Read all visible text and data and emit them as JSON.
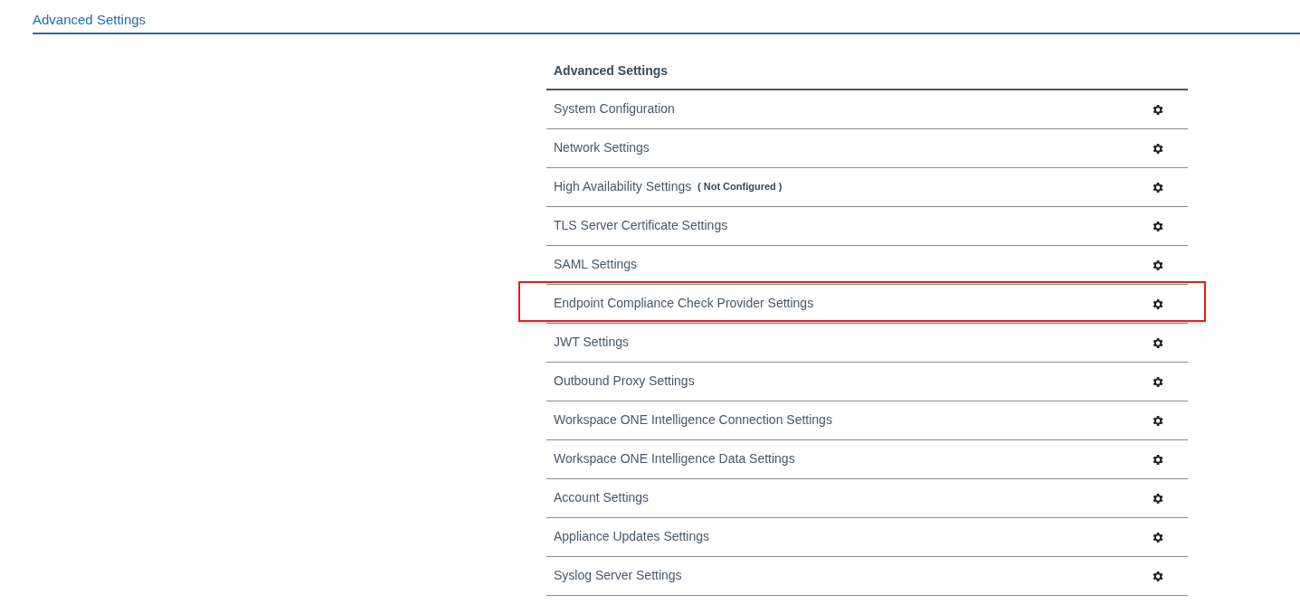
{
  "page_title": "Advanced Settings",
  "panel": {
    "title": "Advanced Settings",
    "rows": [
      {
        "label": "System Configuration",
        "highlighted": false
      },
      {
        "label": "Network Settings",
        "highlighted": false
      },
      {
        "label": "High Availability Settings",
        "status": "( Not Configured )",
        "highlighted": false
      },
      {
        "label": "TLS Server Certificate Settings",
        "highlighted": false
      },
      {
        "label": "SAML Settings",
        "highlighted": false
      },
      {
        "label": "Endpoint Compliance Check Provider Settings",
        "highlighted": true
      },
      {
        "label": "JWT Settings",
        "highlighted": false
      },
      {
        "label": "Outbound Proxy Settings",
        "highlighted": false
      },
      {
        "label": "Workspace ONE Intelligence Connection Settings",
        "highlighted": false
      },
      {
        "label": "Workspace ONE Intelligence Data Settings",
        "highlighted": false
      },
      {
        "label": "Account Settings",
        "highlighted": false
      },
      {
        "label": "Appliance Updates Settings",
        "highlighted": false
      },
      {
        "label": "Syslog Server Settings",
        "highlighted": false
      }
    ]
  }
}
